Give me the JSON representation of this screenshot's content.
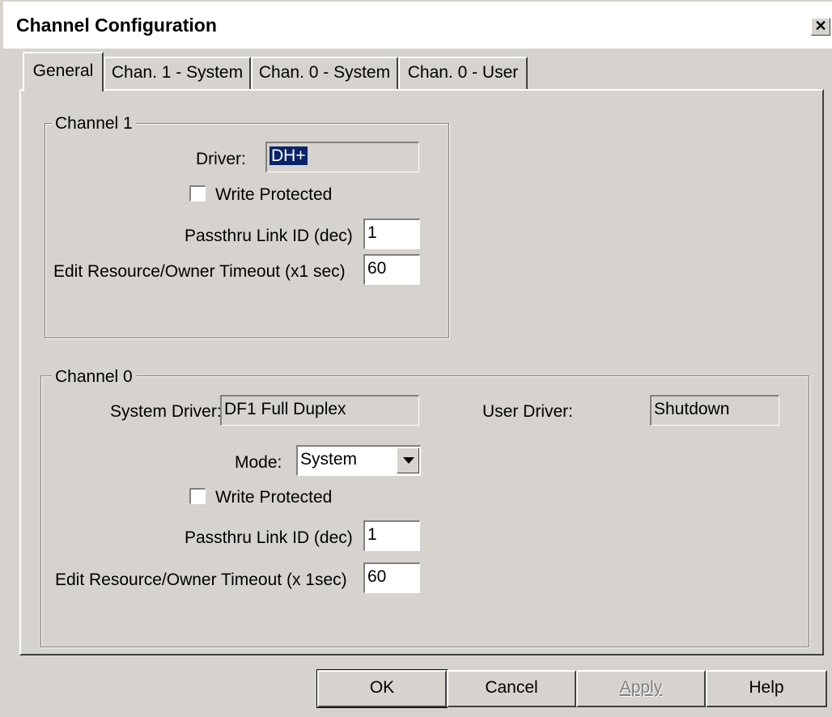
{
  "window": {
    "title": "Channel Configuration",
    "close_glyph": "✕"
  },
  "tabs": [
    {
      "label": "General",
      "active": true
    },
    {
      "label": "Chan. 1 - System",
      "active": false
    },
    {
      "label": "Chan. 0 - System",
      "active": false
    },
    {
      "label": "Chan. 0 - User",
      "active": false
    }
  ],
  "channel1": {
    "legend": "Channel 1",
    "driver_label": "Driver:",
    "driver_value": "DH+",
    "write_protected_label": "Write Protected",
    "write_protected_checked": false,
    "passthru_label": "Passthru Link ID (dec)",
    "passthru_value": "1",
    "timeout_label": "Edit Resource/Owner Timeout (x1 sec)",
    "timeout_value": "60"
  },
  "channel0": {
    "legend": "Channel 0",
    "system_driver_label": "System Driver:",
    "system_driver_value": "DF1 Full Duplex",
    "user_driver_label": "User Driver:",
    "user_driver_value": "Shutdown",
    "mode_label": "Mode:",
    "mode_value": "System",
    "write_protected_label": "Write Protected",
    "write_protected_checked": false,
    "passthru_label": "Passthru Link ID (dec)",
    "passthru_value": "1",
    "timeout_label": "Edit Resource/Owner Timeout (x 1sec)",
    "timeout_value": "60"
  },
  "buttons": {
    "ok": "OK",
    "cancel": "Cancel",
    "apply": "Apply",
    "help": "Help"
  },
  "colors": {
    "dialog_face": "#d6d3ce",
    "selection": "#0a246a"
  }
}
